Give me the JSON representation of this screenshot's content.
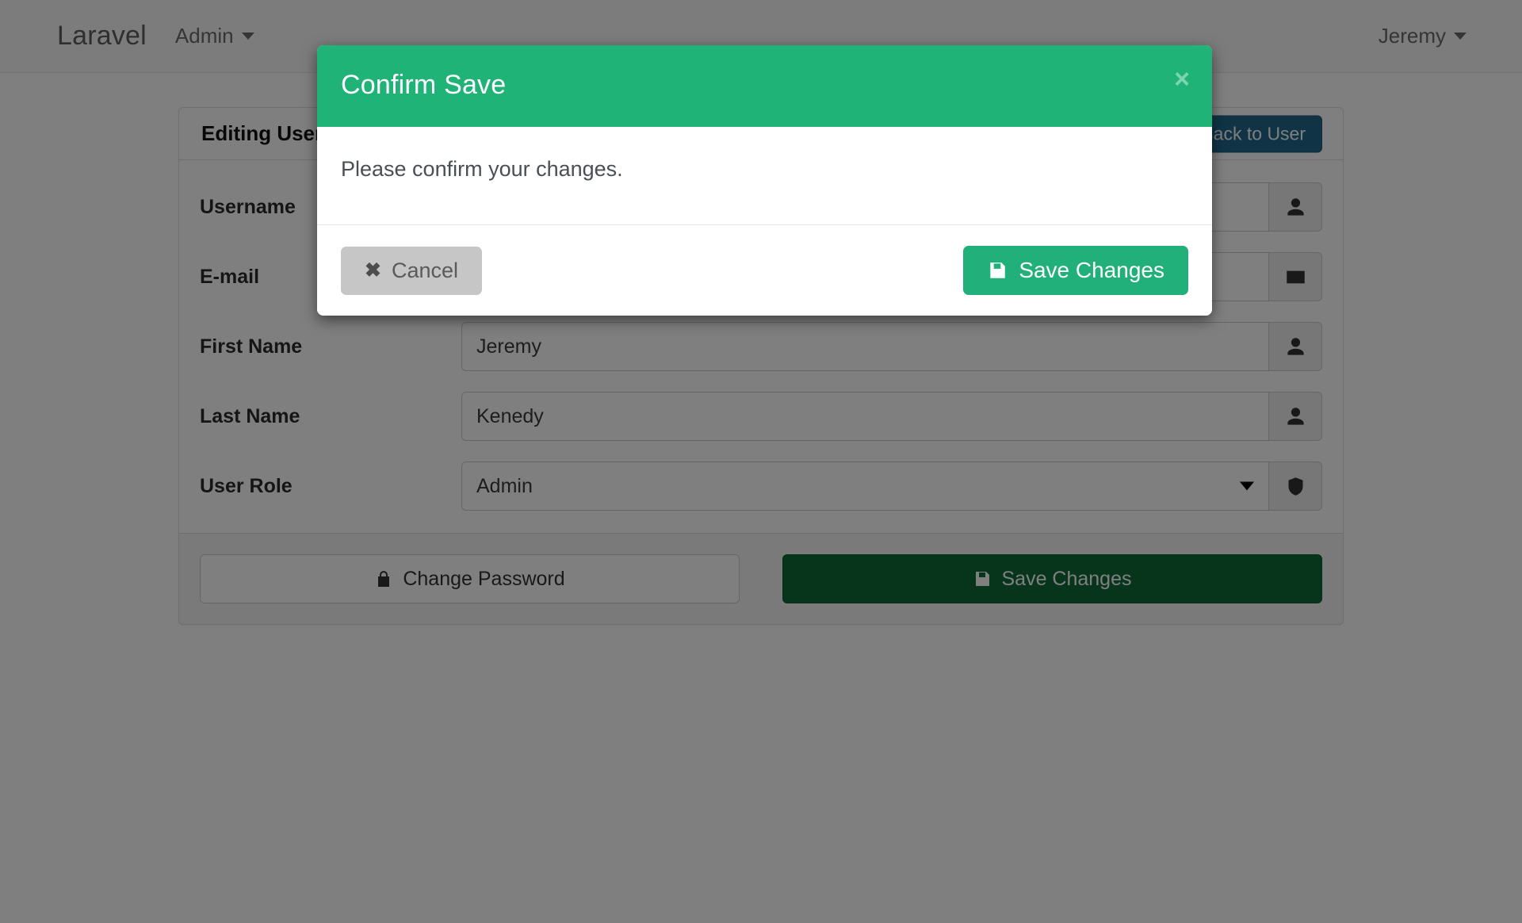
{
  "navbar": {
    "brand": "Laravel",
    "admin_menu": "Admin",
    "user_menu": "Jeremy"
  },
  "panel": {
    "title": "Editing User",
    "back_button": "Back to User",
    "fields": [
      {
        "label": "Username",
        "value": "",
        "icon": "user-icon",
        "type": "text"
      },
      {
        "label": "E-mail",
        "value": "",
        "icon": "envelope-icon",
        "type": "text"
      },
      {
        "label": "First Name",
        "value": "Jeremy",
        "icon": "user-icon",
        "type": "text"
      },
      {
        "label": "Last Name",
        "value": "Kenedy",
        "icon": "user-icon",
        "type": "text"
      },
      {
        "label": "User Role",
        "value": "Admin",
        "icon": "shield-icon",
        "type": "select"
      }
    ],
    "footer": {
      "change_password": "Change Password",
      "save_changes": "Save Changes"
    }
  },
  "modal": {
    "title": "Confirm Save",
    "close_label": "×",
    "body_text": "Please confirm your changes.",
    "cancel_label": "Cancel",
    "save_label": "Save Changes"
  },
  "colors": {
    "modal_header_green": "#20b378",
    "modal_save_green": "#22b07a",
    "panel_save_green": "#0c6b38",
    "back_button_blue": "#20698c",
    "cancel_gray": "#c6c6c6"
  }
}
